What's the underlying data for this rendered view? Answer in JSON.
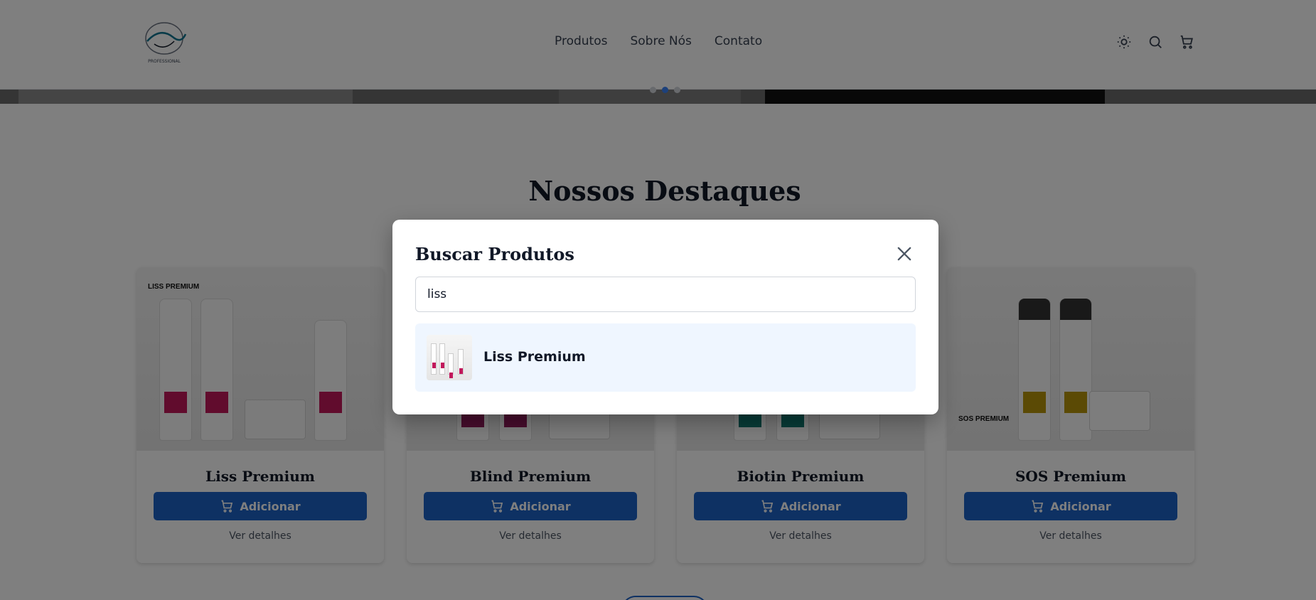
{
  "header": {
    "logo_text": "PROFESSIONAL",
    "nav": [
      {
        "label": "Produtos"
      },
      {
        "label": "Sobre Nós"
      },
      {
        "label": "Contato"
      }
    ]
  },
  "section": {
    "title": "Nossos Destaques"
  },
  "products": [
    {
      "name": "Liss Premium",
      "brand": "LISS PREMIUM",
      "accent": "#c2185b",
      "add_label": "Adicionar",
      "details_label": "Ver detalhes"
    },
    {
      "name": "Blind Premium",
      "brand": "",
      "accent": "#8e1b5a",
      "add_label": "Adicionar",
      "details_label": "Ver detalhes"
    },
    {
      "name": "Biotin Premium",
      "brand": "",
      "accent": "#0f766e",
      "add_label": "Adicionar",
      "details_label": "Ver detalhes"
    },
    {
      "name": "SOS Premium",
      "brand": "SOS PREMIUM",
      "accent": "#b7950b",
      "add_label": "Adicionar",
      "details_label": "Ver detalhes"
    }
  ],
  "modal": {
    "title": "Buscar Produtos",
    "search_value": "liss",
    "results": [
      {
        "name": "Liss Premium"
      }
    ]
  },
  "colors": {
    "primary_button": "#1d63c7",
    "result_highlight": "#eff6ff"
  }
}
